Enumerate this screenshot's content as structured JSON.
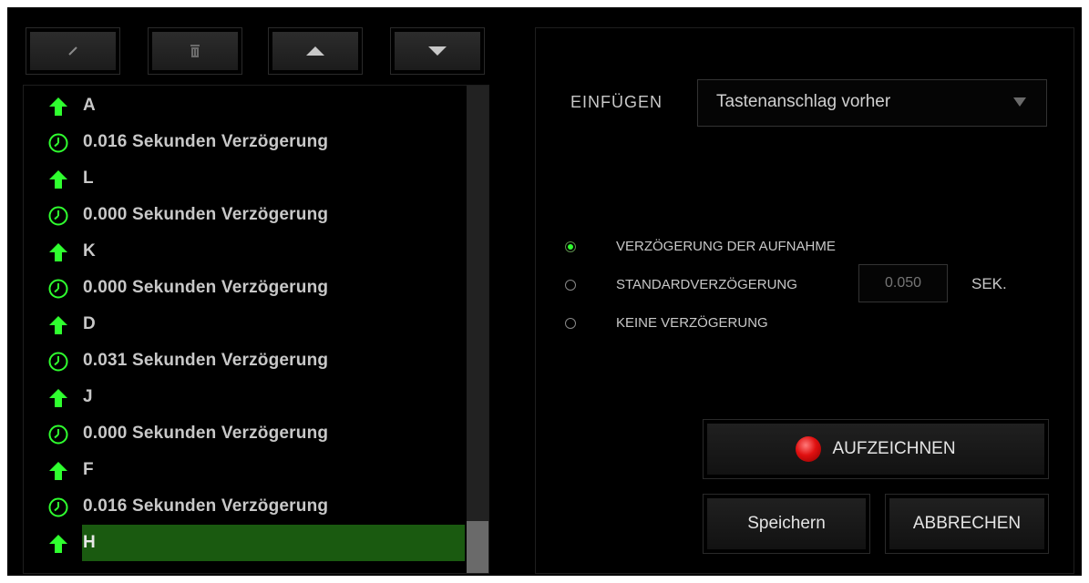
{
  "colors": {
    "accent_green": "#2fff2f",
    "selected_row": "#1a5a10",
    "record_red": "#e01010"
  },
  "toolbar": {
    "buttons": [
      {
        "name": "edit",
        "icon": "pencil-icon"
      },
      {
        "name": "delete",
        "icon": "trash-icon"
      },
      {
        "name": "move-up",
        "icon": "triangle-up-icon"
      },
      {
        "name": "move-down",
        "icon": "triangle-down-icon"
      }
    ]
  },
  "macro_list": {
    "items": [
      {
        "type": "key",
        "icon": "arrow-up-icon",
        "text": "A"
      },
      {
        "type": "delay",
        "icon": "clock-icon",
        "text": "0.016 Sekunden Verzögerung"
      },
      {
        "type": "key",
        "icon": "arrow-up-icon",
        "text": "L"
      },
      {
        "type": "delay",
        "icon": "clock-icon",
        "text": "0.000 Sekunden Verzögerung"
      },
      {
        "type": "key",
        "icon": "arrow-up-icon",
        "text": "K"
      },
      {
        "type": "delay",
        "icon": "clock-icon",
        "text": "0.000 Sekunden Verzögerung"
      },
      {
        "type": "key",
        "icon": "arrow-up-icon",
        "text": "D"
      },
      {
        "type": "delay",
        "icon": "clock-icon",
        "text": "0.031 Sekunden Verzögerung"
      },
      {
        "type": "key",
        "icon": "arrow-up-icon",
        "text": "J"
      },
      {
        "type": "delay",
        "icon": "clock-icon",
        "text": "0.000 Sekunden Verzögerung"
      },
      {
        "type": "key",
        "icon": "arrow-up-icon",
        "text": "F"
      },
      {
        "type": "delay",
        "icon": "clock-icon",
        "text": "0.016 Sekunden Verzögerung"
      },
      {
        "type": "key",
        "icon": "arrow-up-icon",
        "text": "H",
        "selected": true
      }
    ]
  },
  "panel": {
    "insert_label": "EINFÜGEN",
    "insert_select": {
      "value": "Tastenanschlag vorher",
      "icon": "triangle-down-icon"
    },
    "delay_options": [
      {
        "label": "VERZÖGERUNG DER AUFNAHME",
        "selected": true
      },
      {
        "label": "STANDARDVERZÖGERUNG",
        "selected": false
      },
      {
        "label": "KEINE VERZÖGERUNG",
        "selected": false
      }
    ],
    "default_delay": {
      "placeholder": "0.050",
      "unit": "SEK."
    },
    "record_button": {
      "label": "AUFZEICHNEN",
      "icon": "record-icon"
    },
    "save_button": {
      "label": "Speichern"
    },
    "cancel_button": {
      "label": "ABBRECHEN"
    }
  }
}
